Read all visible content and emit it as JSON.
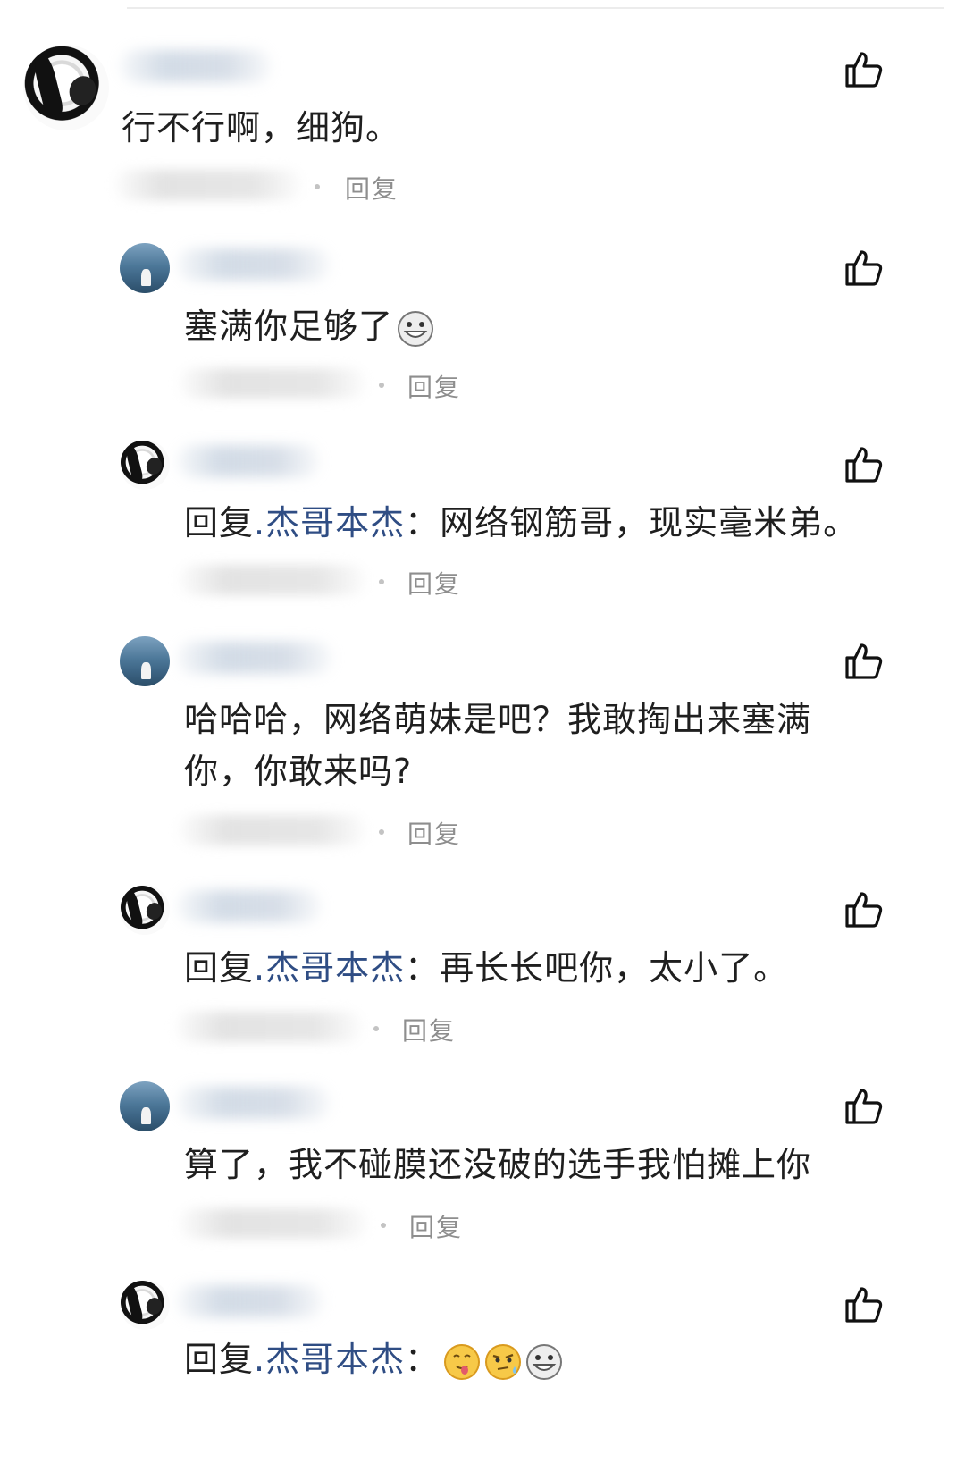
{
  "comments": [
    {
      "avatar": "girl-sketch-avatar",
      "mention": "",
      "text": "行不行啊，细狗。",
      "reply_label": "回复",
      "emojis": [],
      "level": "top"
    },
    {
      "avatar": "seaside-photo-avatar",
      "mention": "",
      "text": "塞满你足够了",
      "reply_label": "回复",
      "emojis": [
        "grinning-face"
      ],
      "level": "reply"
    },
    {
      "avatar": "girl-sketch-avatar",
      "prefix": "回复",
      "mention": ".杰哥本杰",
      "sep": "：",
      "text": "网络钢筋哥，现实毫米弟。",
      "reply_label": "回复",
      "emojis": [],
      "level": "reply"
    },
    {
      "avatar": "seaside-photo-avatar",
      "mention": "",
      "text": "哈哈哈，网络萌妹是吧？我敢掏出来塞满",
      "text2": "你，你敢来吗?",
      "reply_label": "回复",
      "emojis": [],
      "level": "reply"
    },
    {
      "avatar": "girl-sketch-avatar",
      "prefix": "回复",
      "mention": ".杰哥本杰",
      "sep": "：",
      "text": "再长长吧你，太小了。",
      "reply_label": "回复",
      "emojis": [],
      "level": "reply"
    },
    {
      "avatar": "seaside-photo-avatar",
      "mention": "",
      "text": "算了，我不碰膜还没破的选手我怕摊上你",
      "reply_label": "回复",
      "emojis": [],
      "level": "reply"
    },
    {
      "avatar": "girl-sketch-avatar",
      "prefix": "回复",
      "mention": ".杰哥本杰",
      "sep": "：",
      "text": "",
      "reply_label": "",
      "emojis": [
        "tongue-face",
        "thinking-sweat-face",
        "grinning-face"
      ],
      "level": "reply"
    }
  ],
  "colors": {
    "mention": "#2f4d84",
    "text": "#1f1f1f",
    "reply": "#8e8e8e"
  },
  "icons": {
    "like": "thumbs-up-outline-icon"
  }
}
